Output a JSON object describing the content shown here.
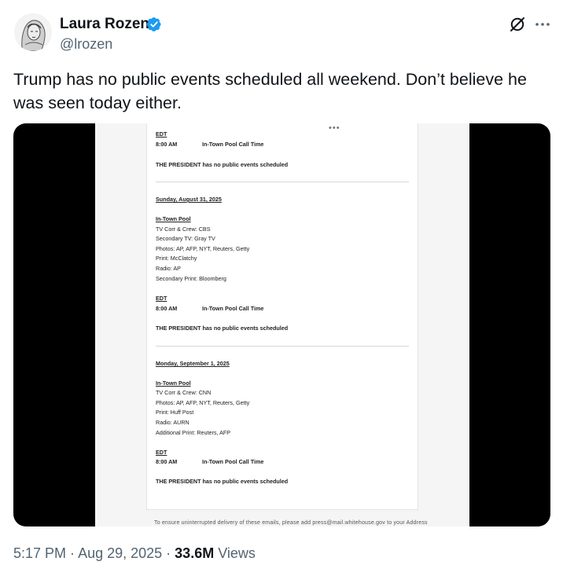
{
  "author": {
    "name": "Laura Rozen",
    "handle": "@lrozen"
  },
  "tweet": {
    "text": "Trump has no public events scheduled all weekend. Don’t believe he was seen today either."
  },
  "media": {
    "top_block": {
      "tz": "EDT",
      "time": "8:00 AM",
      "event": "In-Town Pool Call Time",
      "notice": "THE PRESIDENT has no public events scheduled"
    },
    "days": [
      {
        "date": "Sunday, August 31, 2025",
        "pool_heading": "In-Town Pool",
        "pool_lines": [
          "TV Corr & Crew: CBS",
          "Secondary TV: Gray TV",
          "Photos: AP, AFP, NYT, Reuters, Getty",
          "Print: McClatchy",
          "Radio: AP",
          "Secondary Print: Bloomberg"
        ],
        "tz": "EDT",
        "time": "8:00 AM",
        "event": "In-Town Pool Call Time",
        "notice": "THE PRESIDENT has no public events scheduled"
      },
      {
        "date": "Monday, September 1, 2025",
        "pool_heading": "In-Town Pool",
        "pool_lines": [
          "TV Corr & Crew: CNN",
          "Photos: AP, AFP, NYT, Reuters, Getty",
          "Print: Huff Post",
          "Radio: AURN",
          "Additional Print: Reuters, AFP"
        ],
        "tz": "EDT",
        "time": "8:00 AM",
        "event": "In-Town Pool Call Time",
        "notice": "THE PRESIDENT has no public events scheduled"
      }
    ],
    "footer_text": "To ensure uninterrupted delivery of these emails, please add press@mail.whitehouse.gov to your Address"
  },
  "meta": {
    "time": "5:17 PM",
    "sep1": " · ",
    "date": "Aug 29, 2025",
    "sep2": " · ",
    "views_count": "33.6M",
    "views_label": " Views"
  },
  "colors": {
    "verified_blue": "#1d9bf0",
    "muted_text": "#536471",
    "primary_text": "#0f1419",
    "media_background": "#000000"
  },
  "icons": {
    "verified": "verified-badge-icon",
    "grok": "grok-icon",
    "more": "more-options-icon"
  }
}
